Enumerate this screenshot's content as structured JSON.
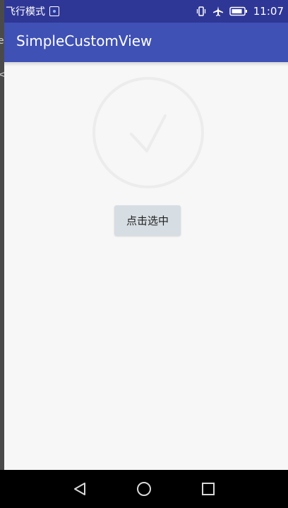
{
  "status_bar": {
    "carrier_text": "飞行模式",
    "time": "11:07",
    "icons": [
      "sim-icon",
      "vibrate-icon",
      "airplane-mode-icon",
      "battery-icon"
    ],
    "background_color": "#2f3796"
  },
  "app_bar": {
    "title": "SimpleCustomView",
    "background_color": "#3f51b5"
  },
  "behind_window_fragments": {
    "top": "e",
    "bottom": "<"
  },
  "content": {
    "check_view": {
      "icon": "checkmark-circle-icon",
      "state": "unchecked",
      "color": "#ececec"
    },
    "select_button": {
      "label": "点击选中"
    }
  },
  "nav_bar": {
    "buttons": [
      "back-icon",
      "home-icon",
      "recents-icon"
    ]
  }
}
